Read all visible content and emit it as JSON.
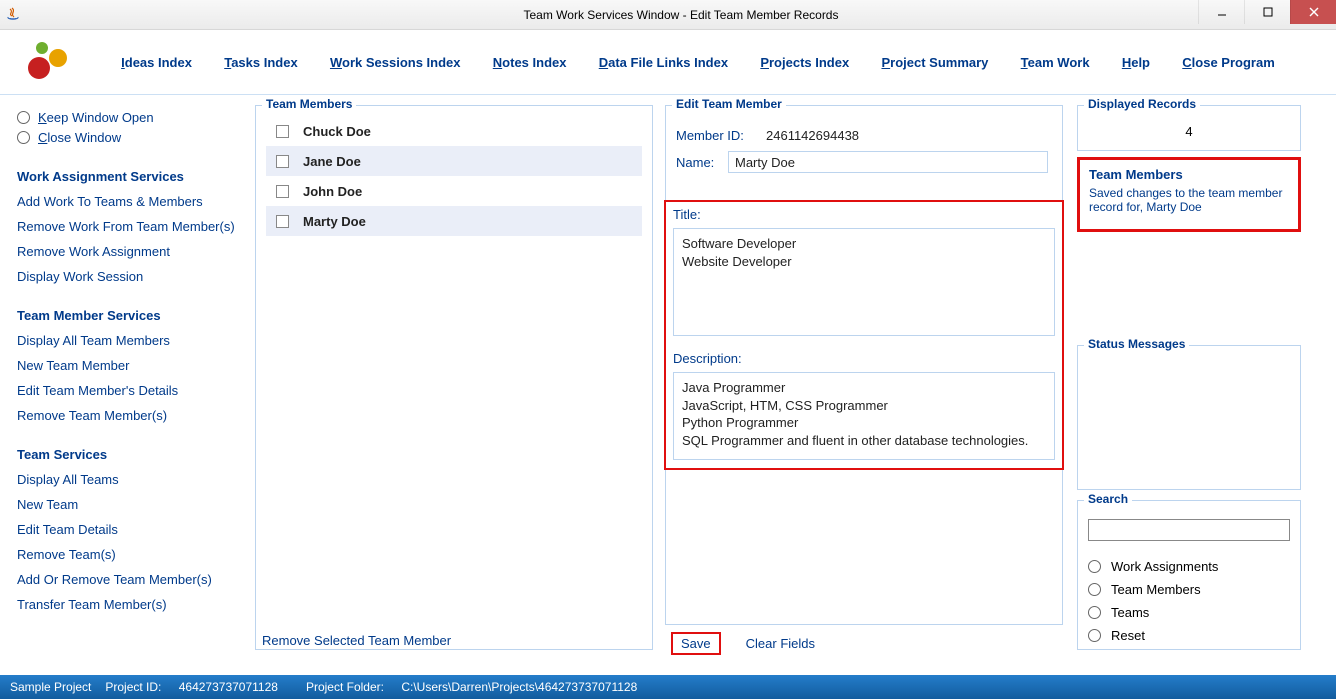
{
  "window": {
    "title": "Team Work Services Window - Edit Team Member Records"
  },
  "menu": {
    "ideas": "Ideas Index",
    "tasks": "Tasks Index",
    "work_sessions": "Work Sessions Index",
    "notes": "Notes Index",
    "data_links": "Data File Links Index",
    "projects": "Projects Index",
    "summary": "Project Summary",
    "team_work": "Team Work",
    "help": "Help",
    "close": "Close Program"
  },
  "left": {
    "keep_open": "Keep Window Open",
    "close_win": "Close Window",
    "sec_was": "Work Assignment Services",
    "was": {
      "add": "Add Work To Teams & Members",
      "remove_member": "Remove Work From Team Member(s)",
      "remove_assign": "Remove Work Assignment",
      "display_ws": "Display Work Session"
    },
    "sec_tms": "Team Member Services",
    "tms": {
      "all": "Display All Team Members",
      "new": "New Team Member",
      "edit": "Edit Team Member's Details",
      "remove": "Remove Team Member(s)"
    },
    "sec_ts": "Team Services",
    "ts": {
      "all": "Display All Teams",
      "new": "New Team",
      "edit": "Edit Team Details",
      "remove": "Remove Team(s)",
      "addremove": "Add Or Remove Team Member(s)",
      "transfer": "Transfer Team Member(s)"
    }
  },
  "members": {
    "title": "Team Members",
    "items": [
      {
        "name": "Chuck Doe",
        "selected": false
      },
      {
        "name": "Jane Doe",
        "selected": false
      },
      {
        "name": "John Doe",
        "selected": false
      },
      {
        "name": "Marty Doe",
        "selected": true
      }
    ],
    "remove_link": "Remove Selected Team Member"
  },
  "edit": {
    "title": "Edit Team Member",
    "member_id_label": "Member ID:",
    "member_id": "2461142694438",
    "name_label": "Name:",
    "name": "Marty Doe",
    "title_label": "Title:",
    "title_text": "Software Developer\nWebsite Developer",
    "desc_label": "Description:",
    "desc_text": "Java Programmer\nJavaScript, HTM, CSS Programmer\nPython Programmer\nSQL Programmer and fluent in other database technologies.",
    "save_label": "Save",
    "clear_label": "Clear Fields"
  },
  "right": {
    "displayed_label": "Displayed Records",
    "displayed_value": "4",
    "tm_section": "Team Members",
    "tm_msg": "Saved changes to the team member record for, Marty Doe",
    "status_label": "Status Messages",
    "search_label": "Search",
    "search_opts": {
      "wa": "Work Assignments",
      "tm": "Team Members",
      "teams": "Teams",
      "reset": "Reset"
    }
  },
  "status": {
    "proj": "Sample Project",
    "pid_label": "Project ID:",
    "pid": "464273737071128",
    "folder_label": "Project Folder:",
    "folder": "C:\\Users\\Darren\\Projects\\464273737071128"
  }
}
